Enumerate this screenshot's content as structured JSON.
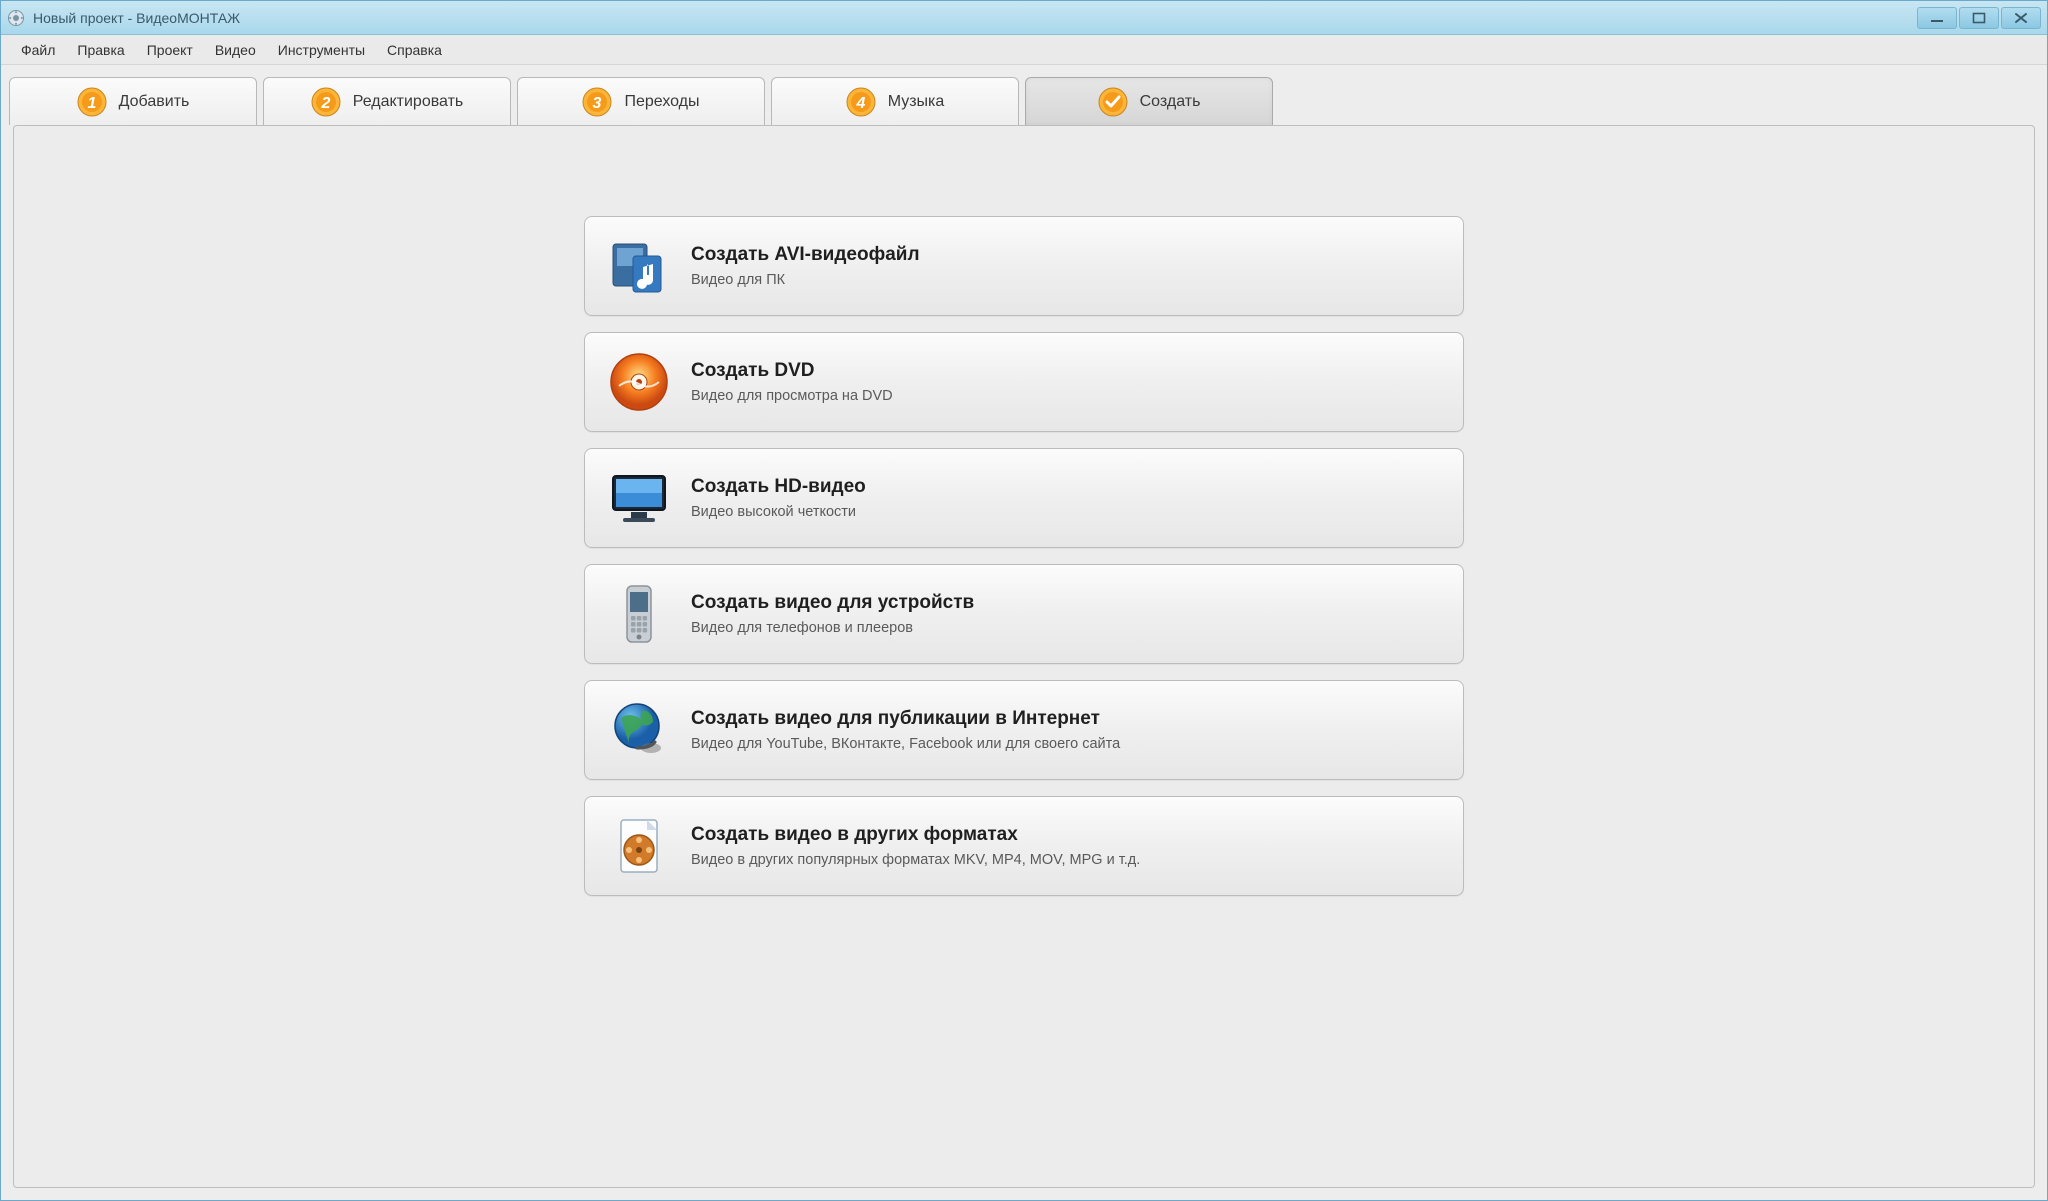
{
  "titlebar": {
    "title": "Новый проект - ВидеоМОНТАЖ"
  },
  "menu": {
    "items": [
      "Файл",
      "Правка",
      "Проект",
      "Видео",
      "Инструменты",
      "Справка"
    ]
  },
  "tabs": [
    {
      "label": "Добавить",
      "number": "1"
    },
    {
      "label": "Редактировать",
      "number": "2"
    },
    {
      "label": "Переходы",
      "number": "3"
    },
    {
      "label": "Музыка",
      "number": "4"
    },
    {
      "label": "Создать",
      "number": "✓",
      "active": true
    }
  ],
  "options": [
    {
      "icon": "avi",
      "title": "Создать AVI-видеофайл",
      "desc": "Видео для ПК"
    },
    {
      "icon": "dvd",
      "title": "Создать DVD",
      "desc": "Видео для просмотра на DVD"
    },
    {
      "icon": "hd",
      "title": "Создать HD-видео",
      "desc": "Видео высокой четкости"
    },
    {
      "icon": "device",
      "title": "Создать видео для устройств",
      "desc": "Видео для телефонов и плееров"
    },
    {
      "icon": "web",
      "title": "Создать видео для публикации в Интернет",
      "desc": "Видео для YouTube, ВКонтакте, Facebook или для своего сайта"
    },
    {
      "icon": "other",
      "title": "Создать видео в других форматах",
      "desc": "Видео в других популярных форматах MKV, MP4, MOV, MPG и т.д."
    }
  ]
}
